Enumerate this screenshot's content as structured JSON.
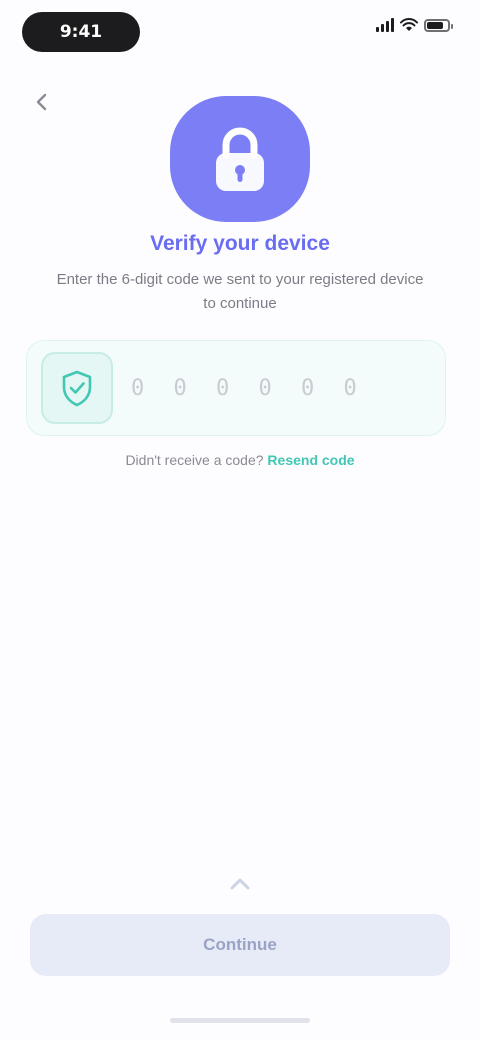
{
  "status_bar": {
    "time": "9:41",
    "icons": [
      "signal-icon",
      "wifi-icon",
      "battery-icon"
    ]
  },
  "nav": {
    "back_icon": "back-arrow-icon"
  },
  "hero": {
    "icon": "lock-icon",
    "title": "Verify your device",
    "subtitle": "Enter the 6-digit code we sent to your registered device to continue"
  },
  "code_field": {
    "icon": "shield-check-icon",
    "value": "",
    "placeholder": "0 0 0 0 0 0"
  },
  "resend": {
    "prompt": "Didn't receive a code?",
    "link": "Resend code"
  },
  "footer": {
    "hint_icon": "chevron-up-icon",
    "continue_label": "Continue"
  },
  "colors": {
    "accent": "#7b7ef4",
    "title": "#6a6df0",
    "teal": "#41c7b3",
    "button_bg": "#e7ebf8"
  }
}
